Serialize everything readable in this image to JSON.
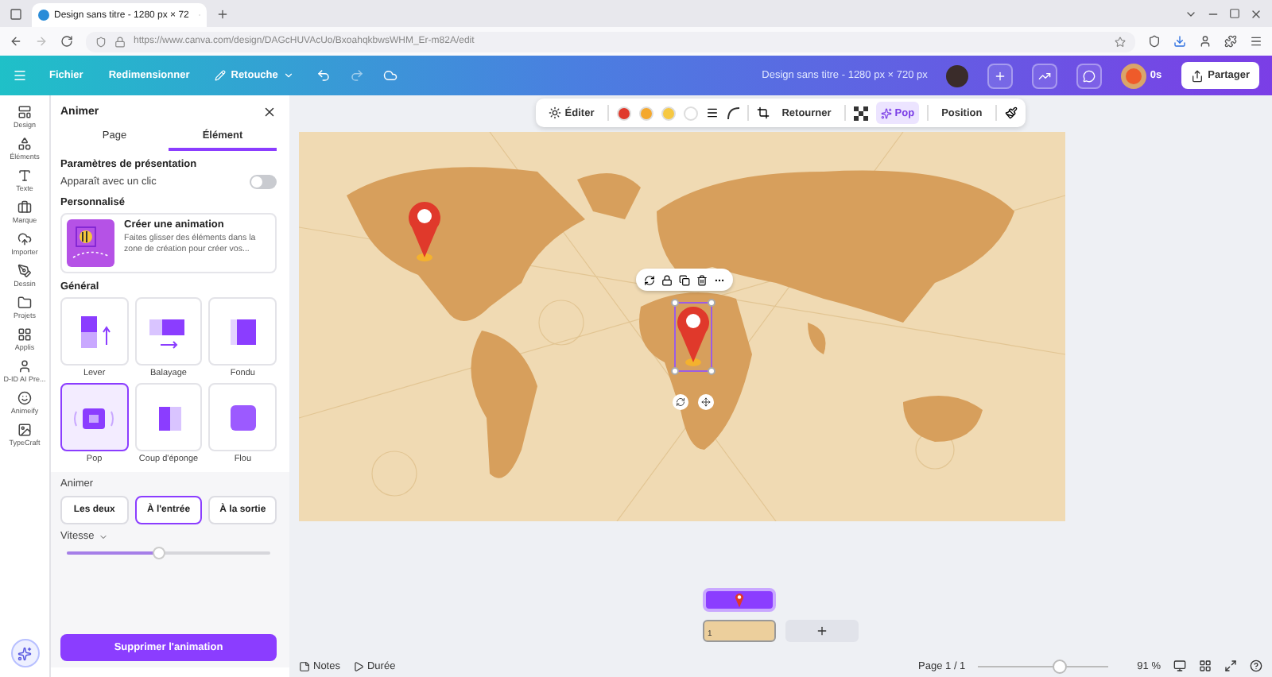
{
  "browser": {
    "tab_title": "Design sans titre - 1280 px × 72",
    "url": "https://www.canva.com/design/DAGcHUVAcUo/BxoahqkbwsWHM_Er-m82A/edit"
  },
  "header": {
    "menu": [
      "Fichier",
      "Redimensionner",
      "Retouche"
    ],
    "title": "Design sans titre - 1280 px × 720 px",
    "timer": "0s",
    "share": "Partager"
  },
  "rail": [
    {
      "label": "Design"
    },
    {
      "label": "Éléments"
    },
    {
      "label": "Texte"
    },
    {
      "label": "Marque"
    },
    {
      "label": "Importer"
    },
    {
      "label": "Dessin"
    },
    {
      "label": "Projets"
    },
    {
      "label": "Applis"
    },
    {
      "label": "D-ID AI Pre..."
    },
    {
      "label": "Animeify"
    },
    {
      "label": "TypeCraft"
    }
  ],
  "panel": {
    "title": "Animer",
    "tabs": [
      {
        "label": "Page",
        "selected": false
      },
      {
        "label": "Élément",
        "selected": true
      }
    ],
    "settings_heading": "Paramètres de présentation",
    "toggle": {
      "label": "Apparaît avec un clic",
      "on": false
    },
    "custom_heading": "Personnalisé",
    "custom_card": {
      "title": "Créer une animation",
      "description": "Faites glisser des éléments dans la zone de création pour créer vos..."
    },
    "general_heading": "Général",
    "effects": [
      {
        "label": "Lever",
        "selected": false
      },
      {
        "label": "Balayage",
        "selected": false
      },
      {
        "label": "Fondu",
        "selected": false
      },
      {
        "label": "Pop",
        "selected": true
      },
      {
        "label": "Coup d'éponge",
        "selected": false
      },
      {
        "label": "Flou",
        "selected": false
      }
    ],
    "animate_heading": "Animer",
    "modes": [
      {
        "label": "Les deux",
        "selected": false
      },
      {
        "label": "À l'entrée",
        "selected": true
      },
      {
        "label": "À la sortie",
        "selected": false
      }
    ],
    "speed": {
      "label": "Vitesse",
      "level": 0.45
    },
    "delete_button": "Supprimer l'animation"
  },
  "toolbar": {
    "edit": "Éditer",
    "colors": [
      {
        "color": "#e0392b"
      },
      {
        "color": "#f4a82e"
      },
      {
        "color": "#f6c842"
      },
      {
        "color": "#ffffff"
      }
    ],
    "flip": "Retourner",
    "animation": {
      "label": "Pop",
      "selected": true
    },
    "position": "Position"
  },
  "timeline": {
    "page_number": "1"
  },
  "footer": {
    "notes": "Notes",
    "duration": "Durée",
    "page": "Page 1 / 1",
    "zoom": {
      "level": 0.62,
      "reading": "91 %"
    }
  }
}
